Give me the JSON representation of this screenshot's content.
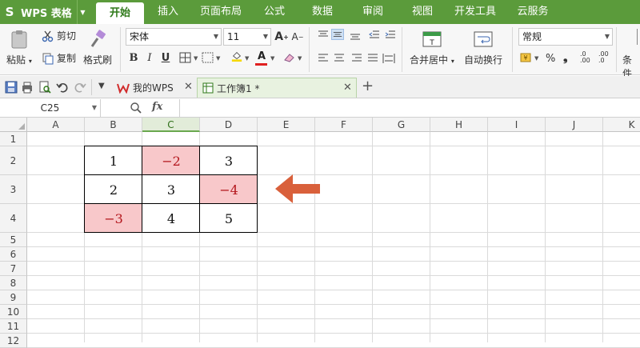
{
  "app": {
    "name": "WPS 表格",
    "logo_letter": "S"
  },
  "menu_tabs": [
    "开始",
    "插入",
    "页面布局",
    "公式",
    "数据",
    "审阅",
    "视图",
    "开发工具",
    "云服务"
  ],
  "active_menu_tab": "开始",
  "ribbon": {
    "paste": "粘贴",
    "cut": "剪切",
    "copy": "复制",
    "format_painter": "格式刷",
    "font_name": "宋体",
    "font_size": "11",
    "merge_center": "合并居中",
    "wrap_text": "自动换行",
    "number_format": "常规",
    "percent": "%",
    "thousands": "❟",
    "inc_decimal": ".0 .00",
    "dec_decimal": ".00 .0",
    "conditional": "条件"
  },
  "doc_tabs": {
    "my_wps": "我的WPS",
    "workbook": "工作簿1 *",
    "add": "+"
  },
  "formula_bar": {
    "name_box": "C25",
    "fx": "fx",
    "formula": ""
  },
  "columns": [
    "A",
    "B",
    "C",
    "D",
    "E",
    "F",
    "G",
    "H",
    "I",
    "J",
    "K"
  ],
  "selected_column": "C",
  "rows": [
    "1",
    "2",
    "3",
    "4",
    "5",
    "6",
    "7",
    "8",
    "9",
    "10",
    "11",
    "12"
  ],
  "table": {
    "rows": [
      [
        {
          "value": "1",
          "neg": false
        },
        {
          "value": "−2",
          "neg": true
        },
        {
          "value": "3",
          "neg": false
        }
      ],
      [
        {
          "value": "2",
          "neg": false
        },
        {
          "value": "3",
          "neg": false
        },
        {
          "value": "−4",
          "neg": true
        }
      ],
      [
        {
          "value": "−3",
          "neg": true
        },
        {
          "value": "4",
          "neg": false
        },
        {
          "value": "5",
          "neg": false
        }
      ]
    ]
  },
  "colors": {
    "menubar": "#5b9b3b",
    "negative_fill": "#f8c8ca",
    "negative_text": "#b3161c",
    "arrow": "#d9603b"
  }
}
